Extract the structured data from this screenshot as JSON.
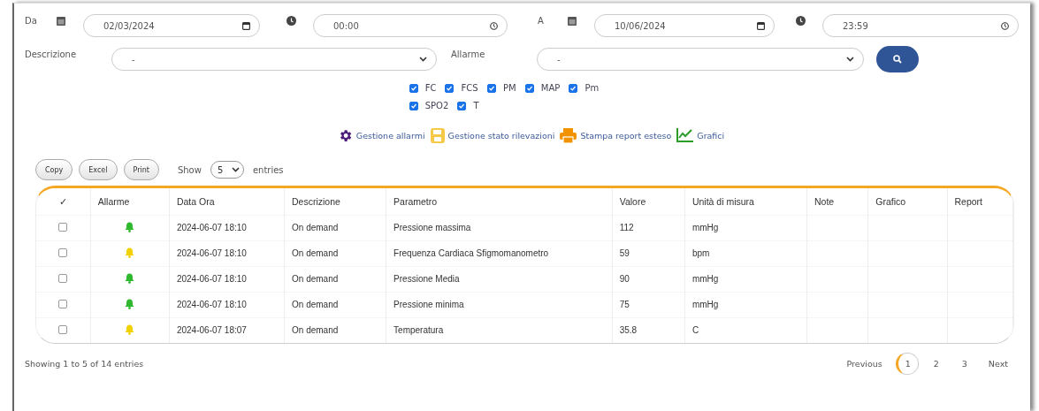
{
  "filters": {
    "from_label": "Da",
    "from_date": "02/03/2024",
    "from_time": "00:00",
    "to_label": "A",
    "to_date": "10/06/2024",
    "to_time": "23:59",
    "description_label": "Descrizione",
    "description_value": "-",
    "alarm_label": "Allarme",
    "alarm_value": "-"
  },
  "parameters": [
    {
      "label": "FC",
      "checked": true
    },
    {
      "label": "FCS",
      "checked": true
    },
    {
      "label": "PM",
      "checked": true
    },
    {
      "label": "MAP",
      "checked": true
    },
    {
      "label": "Pm",
      "checked": true
    },
    {
      "label": "SPO2",
      "checked": true
    },
    {
      "label": "T",
      "checked": true
    }
  ],
  "actions": [
    {
      "kind": "gear",
      "label": "Gestione allarmi"
    },
    {
      "kind": "save",
      "label": "Gestione stato rilevazioni"
    },
    {
      "kind": "print",
      "label": "Stampa report esteso"
    },
    {
      "kind": "chart",
      "label": "Grafici"
    }
  ],
  "export_buttons": [
    "Copy",
    "Excel",
    "Print"
  ],
  "length": {
    "before": "Show",
    "value": "5",
    "after": "entries"
  },
  "table": {
    "columns": [
      "✓",
      "Allarme",
      "Data Ora",
      "Descrizione",
      "Parametro",
      "Valore",
      "Unità di misura",
      "Note",
      "Grafico",
      "Report"
    ],
    "rows": [
      {
        "cells": [
          {
            "kind": "checkbox",
            "checked": false
          },
          {
            "kind": "alarm",
            "color": "#2eb82e"
          },
          "2024-06-07 18:10",
          "On demand",
          "Pressione massima",
          "112",
          "mmHg"
        ]
      },
      {
        "cells": [
          {
            "kind": "checkbox",
            "checked": false
          },
          {
            "kind": "alarm",
            "color": "#f2d100"
          },
          "2024-06-07 18:10",
          "On demand",
          "Frequenza Cardiaca Sfigmomanometro",
          "59",
          "bpm"
        ]
      },
      {
        "cells": [
          {
            "kind": "checkbox",
            "checked": false
          },
          {
            "kind": "alarm",
            "color": "#2eb82e"
          },
          "2024-06-07 18:10",
          "On demand",
          "Pressione Media",
          "90",
          "mmHg"
        ]
      },
      {
        "cells": [
          {
            "kind": "checkbox",
            "checked": false
          },
          {
            "kind": "alarm",
            "color": "#2eb82e"
          },
          "2024-06-07 18:10",
          "On demand",
          "Pressione minima",
          "75",
          "mmHg"
        ]
      },
      {
        "cells": [
          {
            "kind": "checkbox",
            "checked": false
          },
          {
            "kind": "alarm",
            "color": "#f2d100"
          },
          "2024-06-07 18:07",
          "On demand",
          "Temperatura",
          "35.8",
          "C"
        ]
      }
    ]
  },
  "info": "Showing 1 to 5 of 14 entries",
  "pagination": {
    "previous": "Previous",
    "pages": [
      {
        "label": "1",
        "selected": true
      },
      {
        "label": "2",
        "selected": false
      },
      {
        "label": "3",
        "selected": false
      }
    ],
    "next": "Next"
  }
}
